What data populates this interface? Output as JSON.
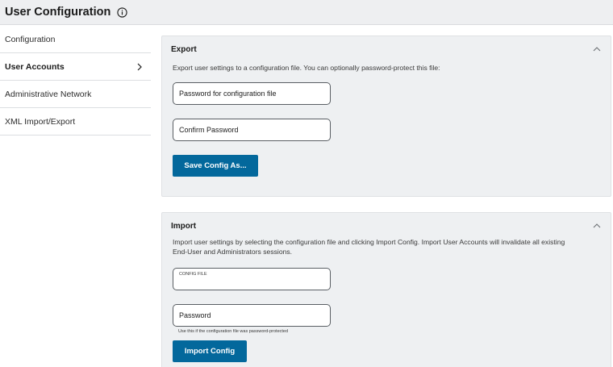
{
  "header": {
    "title": "User Configuration",
    "info_icon": "info-icon"
  },
  "sidebar": {
    "items": [
      {
        "label": "Configuration",
        "active": false
      },
      {
        "label": "User Accounts",
        "active": true
      },
      {
        "label": "Administrative Network",
        "active": false
      },
      {
        "label": "XML Import/Export",
        "active": false
      }
    ]
  },
  "export": {
    "title": "Export",
    "description": "Export user settings to a configuration file. You can optionally password-protect this file:",
    "password_field": "Password for configuration file",
    "confirm_field": "Confirm Password",
    "button": "Save Config As..."
  },
  "import": {
    "title": "Import",
    "description": "Import user settings by selecting the configuration file and clicking Import Config. Import User Accounts will invalidate all existing End-User and Administrators sessions.",
    "file_field": "CONFIG FILE",
    "password_field": "Password",
    "password_hint": "Use this if the configuration file was password-protected",
    "button": "Import Config"
  },
  "colors": {
    "primary_button": "#03689c",
    "card_bg": "#eef0f2",
    "header_bg": "#eeeff1"
  }
}
